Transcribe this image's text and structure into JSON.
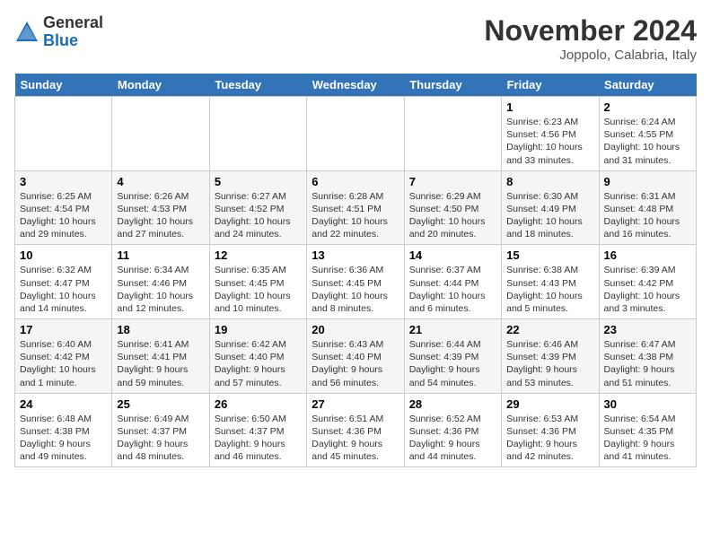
{
  "header": {
    "logo_general": "General",
    "logo_blue": "Blue",
    "month_title": "November 2024",
    "location": "Joppolo, Calabria, Italy"
  },
  "weekdays": [
    "Sunday",
    "Monday",
    "Tuesday",
    "Wednesday",
    "Thursday",
    "Friday",
    "Saturday"
  ],
  "weeks": [
    [
      {
        "day": "",
        "info": ""
      },
      {
        "day": "",
        "info": ""
      },
      {
        "day": "",
        "info": ""
      },
      {
        "day": "",
        "info": ""
      },
      {
        "day": "",
        "info": ""
      },
      {
        "day": "1",
        "info": "Sunrise: 6:23 AM\nSunset: 4:56 PM\nDaylight: 10 hours and 33 minutes."
      },
      {
        "day": "2",
        "info": "Sunrise: 6:24 AM\nSunset: 4:55 PM\nDaylight: 10 hours and 31 minutes."
      }
    ],
    [
      {
        "day": "3",
        "info": "Sunrise: 6:25 AM\nSunset: 4:54 PM\nDaylight: 10 hours and 29 minutes."
      },
      {
        "day": "4",
        "info": "Sunrise: 6:26 AM\nSunset: 4:53 PM\nDaylight: 10 hours and 27 minutes."
      },
      {
        "day": "5",
        "info": "Sunrise: 6:27 AM\nSunset: 4:52 PM\nDaylight: 10 hours and 24 minutes."
      },
      {
        "day": "6",
        "info": "Sunrise: 6:28 AM\nSunset: 4:51 PM\nDaylight: 10 hours and 22 minutes."
      },
      {
        "day": "7",
        "info": "Sunrise: 6:29 AM\nSunset: 4:50 PM\nDaylight: 10 hours and 20 minutes."
      },
      {
        "day": "8",
        "info": "Sunrise: 6:30 AM\nSunset: 4:49 PM\nDaylight: 10 hours and 18 minutes."
      },
      {
        "day": "9",
        "info": "Sunrise: 6:31 AM\nSunset: 4:48 PM\nDaylight: 10 hours and 16 minutes."
      }
    ],
    [
      {
        "day": "10",
        "info": "Sunrise: 6:32 AM\nSunset: 4:47 PM\nDaylight: 10 hours and 14 minutes."
      },
      {
        "day": "11",
        "info": "Sunrise: 6:34 AM\nSunset: 4:46 PM\nDaylight: 10 hours and 12 minutes."
      },
      {
        "day": "12",
        "info": "Sunrise: 6:35 AM\nSunset: 4:45 PM\nDaylight: 10 hours and 10 minutes."
      },
      {
        "day": "13",
        "info": "Sunrise: 6:36 AM\nSunset: 4:45 PM\nDaylight: 10 hours and 8 minutes."
      },
      {
        "day": "14",
        "info": "Sunrise: 6:37 AM\nSunset: 4:44 PM\nDaylight: 10 hours and 6 minutes."
      },
      {
        "day": "15",
        "info": "Sunrise: 6:38 AM\nSunset: 4:43 PM\nDaylight: 10 hours and 5 minutes."
      },
      {
        "day": "16",
        "info": "Sunrise: 6:39 AM\nSunset: 4:42 PM\nDaylight: 10 hours and 3 minutes."
      }
    ],
    [
      {
        "day": "17",
        "info": "Sunrise: 6:40 AM\nSunset: 4:42 PM\nDaylight: 10 hours and 1 minute."
      },
      {
        "day": "18",
        "info": "Sunrise: 6:41 AM\nSunset: 4:41 PM\nDaylight: 9 hours and 59 minutes."
      },
      {
        "day": "19",
        "info": "Sunrise: 6:42 AM\nSunset: 4:40 PM\nDaylight: 9 hours and 57 minutes."
      },
      {
        "day": "20",
        "info": "Sunrise: 6:43 AM\nSunset: 4:40 PM\nDaylight: 9 hours and 56 minutes."
      },
      {
        "day": "21",
        "info": "Sunrise: 6:44 AM\nSunset: 4:39 PM\nDaylight: 9 hours and 54 minutes."
      },
      {
        "day": "22",
        "info": "Sunrise: 6:46 AM\nSunset: 4:39 PM\nDaylight: 9 hours and 53 minutes."
      },
      {
        "day": "23",
        "info": "Sunrise: 6:47 AM\nSunset: 4:38 PM\nDaylight: 9 hours and 51 minutes."
      }
    ],
    [
      {
        "day": "24",
        "info": "Sunrise: 6:48 AM\nSunset: 4:38 PM\nDaylight: 9 hours and 49 minutes."
      },
      {
        "day": "25",
        "info": "Sunrise: 6:49 AM\nSunset: 4:37 PM\nDaylight: 9 hours and 48 minutes."
      },
      {
        "day": "26",
        "info": "Sunrise: 6:50 AM\nSunset: 4:37 PM\nDaylight: 9 hours and 46 minutes."
      },
      {
        "day": "27",
        "info": "Sunrise: 6:51 AM\nSunset: 4:36 PM\nDaylight: 9 hours and 45 minutes."
      },
      {
        "day": "28",
        "info": "Sunrise: 6:52 AM\nSunset: 4:36 PM\nDaylight: 9 hours and 44 minutes."
      },
      {
        "day": "29",
        "info": "Sunrise: 6:53 AM\nSunset: 4:36 PM\nDaylight: 9 hours and 42 minutes."
      },
      {
        "day": "30",
        "info": "Sunrise: 6:54 AM\nSunset: 4:35 PM\nDaylight: 9 hours and 41 minutes."
      }
    ]
  ]
}
